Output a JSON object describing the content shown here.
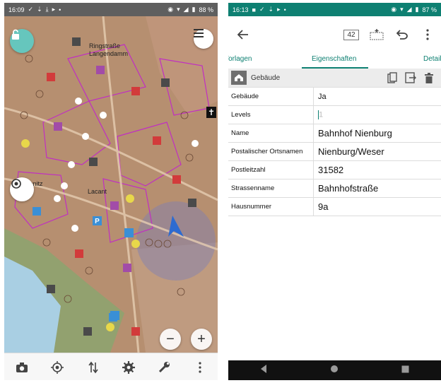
{
  "left_screen": {
    "status": {
      "time": "16:09",
      "battery": "88 %"
    },
    "map": {
      "labels": [
        "Ringstraße",
        "Langendamm",
        "menitz",
        "Lacant"
      ],
      "poi_letter": "P"
    },
    "bottom_bar": [
      "camera-icon",
      "gps-icon",
      "transfer-icon",
      "settings-icon",
      "tools-icon",
      "more-icon"
    ]
  },
  "right_screen": {
    "status": {
      "time": "16:13",
      "battery": "87 %"
    },
    "toolbar": {
      "badge": "42"
    },
    "tabs": {
      "left": "Vorlagen",
      "active": "Eigenschaften",
      "right": "Details"
    },
    "section": {
      "title": "Gebäude"
    },
    "rows": [
      {
        "key": "Gebäude",
        "value": "Ja"
      },
      {
        "key": "Levels",
        "value": "1"
      },
      {
        "key": "Name",
        "value": "Bahnhof Nienburg"
      },
      {
        "key": "Postalischer Ortsnamen",
        "value": "Nienburg/Weser"
      },
      {
        "key": "Postleitzahl",
        "value": "31582"
      },
      {
        "key": "Strassenname",
        "value": "Bahnhofstraße"
      },
      {
        "key": "Hausnummer",
        "value": "9a"
      }
    ]
  },
  "colors": {
    "accent": "#0e8072",
    "map_bg": "#b99274",
    "water": "#a9cfe3",
    "building_outline": "#c02fc2"
  }
}
